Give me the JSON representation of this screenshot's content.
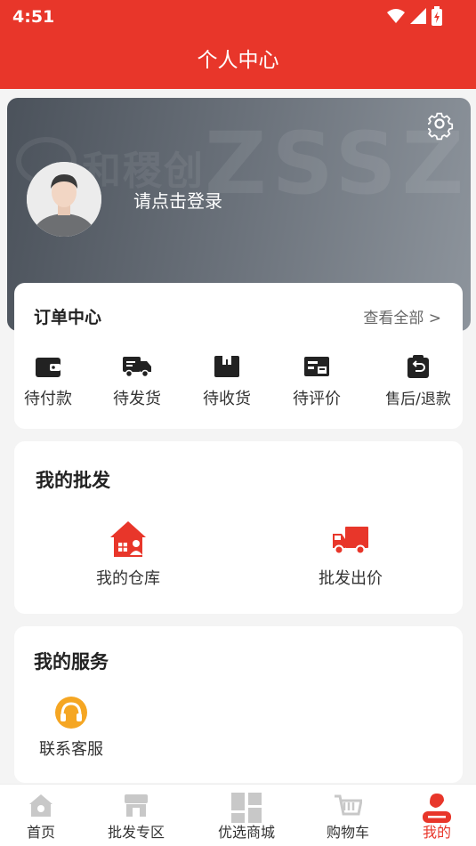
{
  "status_bar": {
    "time": "4:51"
  },
  "header": {
    "title": "个人中心"
  },
  "profile": {
    "login_prompt": "请点击登录",
    "watermark_cn": "和稷创",
    "watermark_en": "ZSSZ"
  },
  "orders": {
    "title": "订单中心",
    "view_all": "查看全部 >",
    "items": [
      {
        "label": "待付款",
        "icon": "wallet-icon"
      },
      {
        "label": "待发货",
        "icon": "truck-icon"
      },
      {
        "label": "待收货",
        "icon": "box-icon"
      },
      {
        "label": "待评价",
        "icon": "review-icon"
      },
      {
        "label": "售后/退款",
        "icon": "refund-icon"
      }
    ]
  },
  "wholesale": {
    "title": "我的批发",
    "items": [
      {
        "label": "我的仓库",
        "icon": "warehouse-icon"
      },
      {
        "label": "批发出价",
        "icon": "delivery-truck-icon"
      }
    ]
  },
  "services": {
    "title": "我的服务",
    "items": [
      {
        "label": "联系客服",
        "icon": "headset-icon"
      }
    ]
  },
  "tabbar": {
    "items": [
      {
        "label": "首页",
        "icon": "home-icon"
      },
      {
        "label": "批发专区",
        "icon": "store-icon"
      },
      {
        "label": "优选商城",
        "icon": "grid-icon"
      },
      {
        "label": "购物车",
        "icon": "cart-icon"
      },
      {
        "label": "我的",
        "icon": "profile-icon"
      }
    ],
    "active": "我的"
  },
  "colors": {
    "primary": "#e8362a",
    "header_bg": "#e8362a",
    "tab_inactive": "#c8c8c8",
    "service_icon": "#f5a623"
  }
}
